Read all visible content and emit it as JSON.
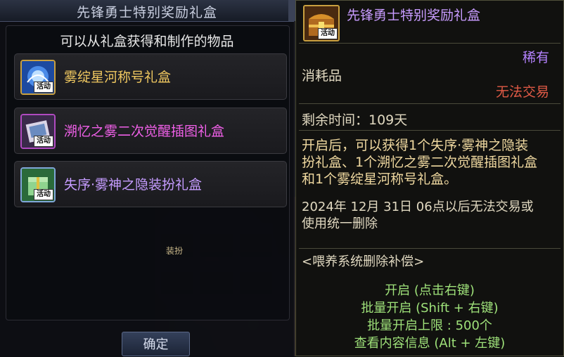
{
  "dialog": {
    "title": "先锋勇士特别奖励礼盒",
    "subheading": "可以从礼盒获得和制作的物品",
    "confirm_label": "确定",
    "items": [
      {
        "name": "雾绽星河称号礼盒",
        "color": "#f0c860",
        "tag": "活动"
      },
      {
        "name": "溯忆之雾二次觉醒插图礼盒",
        "color": "#f060e8",
        "tag": "活动"
      },
      {
        "name": "失序·雾神之隐装扮礼盒",
        "color": "#c59cff",
        "tag": "活动"
      }
    ]
  },
  "background": {
    "slot_label": "装扮"
  },
  "tooltip": {
    "title": "先锋勇士特别奖励礼盒",
    "icon_tag": "活动",
    "rarity": "稀有",
    "type": "消耗品",
    "trade": "无法交易",
    "time": "剩余时间：109天",
    "description": "开启后，可以获得1个失序·雾神之隐装扮礼盒、1个溯忆之雾二次觉醒插图礼盒和1个雾绽星河称号礼盒。",
    "notice": "2024年 12月 31日 06点以后无法交易或使用统一删除",
    "compensation": "<喂养系统删除补偿>",
    "commands": [
      "开启 (点击右键)",
      "批量开启 (Shift + 右键)",
      "批量开启上限 : 500个",
      "查看内容信息 (Alt + 左键)"
    ]
  },
  "colors": {
    "rarity": "#b583ff",
    "trade": "#e05a46",
    "description": "#f0d9a0",
    "command": "#9fe27a"
  }
}
